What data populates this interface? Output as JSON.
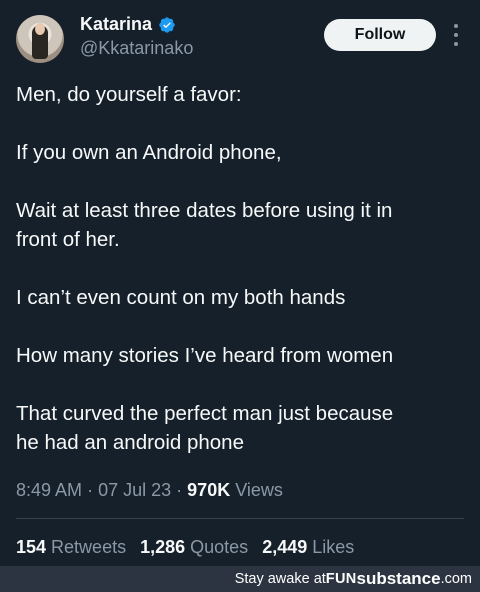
{
  "user": {
    "name": "Katarina",
    "handle": "@Kkatarinako",
    "verified_icon": "verified-badge-icon",
    "avatar": "profile-photo"
  },
  "header": {
    "follow_label": "Follow",
    "more_icon": "more-vertical-icon"
  },
  "tweet": {
    "lines": [
      "Men, do yourself a favor:",
      "If you own an Android phone,",
      "Wait at least three dates before using it in",
      "front of her.",
      "I can’t even count on my both hands",
      "How many stories I’ve heard from women",
      "That curved the perfect man just because",
      "he had an android phone"
    ]
  },
  "meta": {
    "time": "8:49 AM",
    "sep1": "·",
    "date": "07 Jul 23",
    "sep2": "·",
    "views_count": "970K",
    "views_label": "Views"
  },
  "stats": {
    "retweets_count": "154",
    "retweets_label": "Retweets",
    "quotes_count": "1,286",
    "quotes_label": "Quotes",
    "likes_count": "2,449",
    "likes_label": "Likes"
  },
  "watermark": {
    "prefix": "Stay awake at ",
    "brand_fun": "FUN",
    "brand_substance": "substance",
    "brand_tld": ".com"
  },
  "colors": {
    "background": "#15202b",
    "text": "#f7f9f9",
    "secondary": "#8b98a5",
    "verified": "#1d9bf0",
    "follow_bg": "#eff3f4"
  }
}
